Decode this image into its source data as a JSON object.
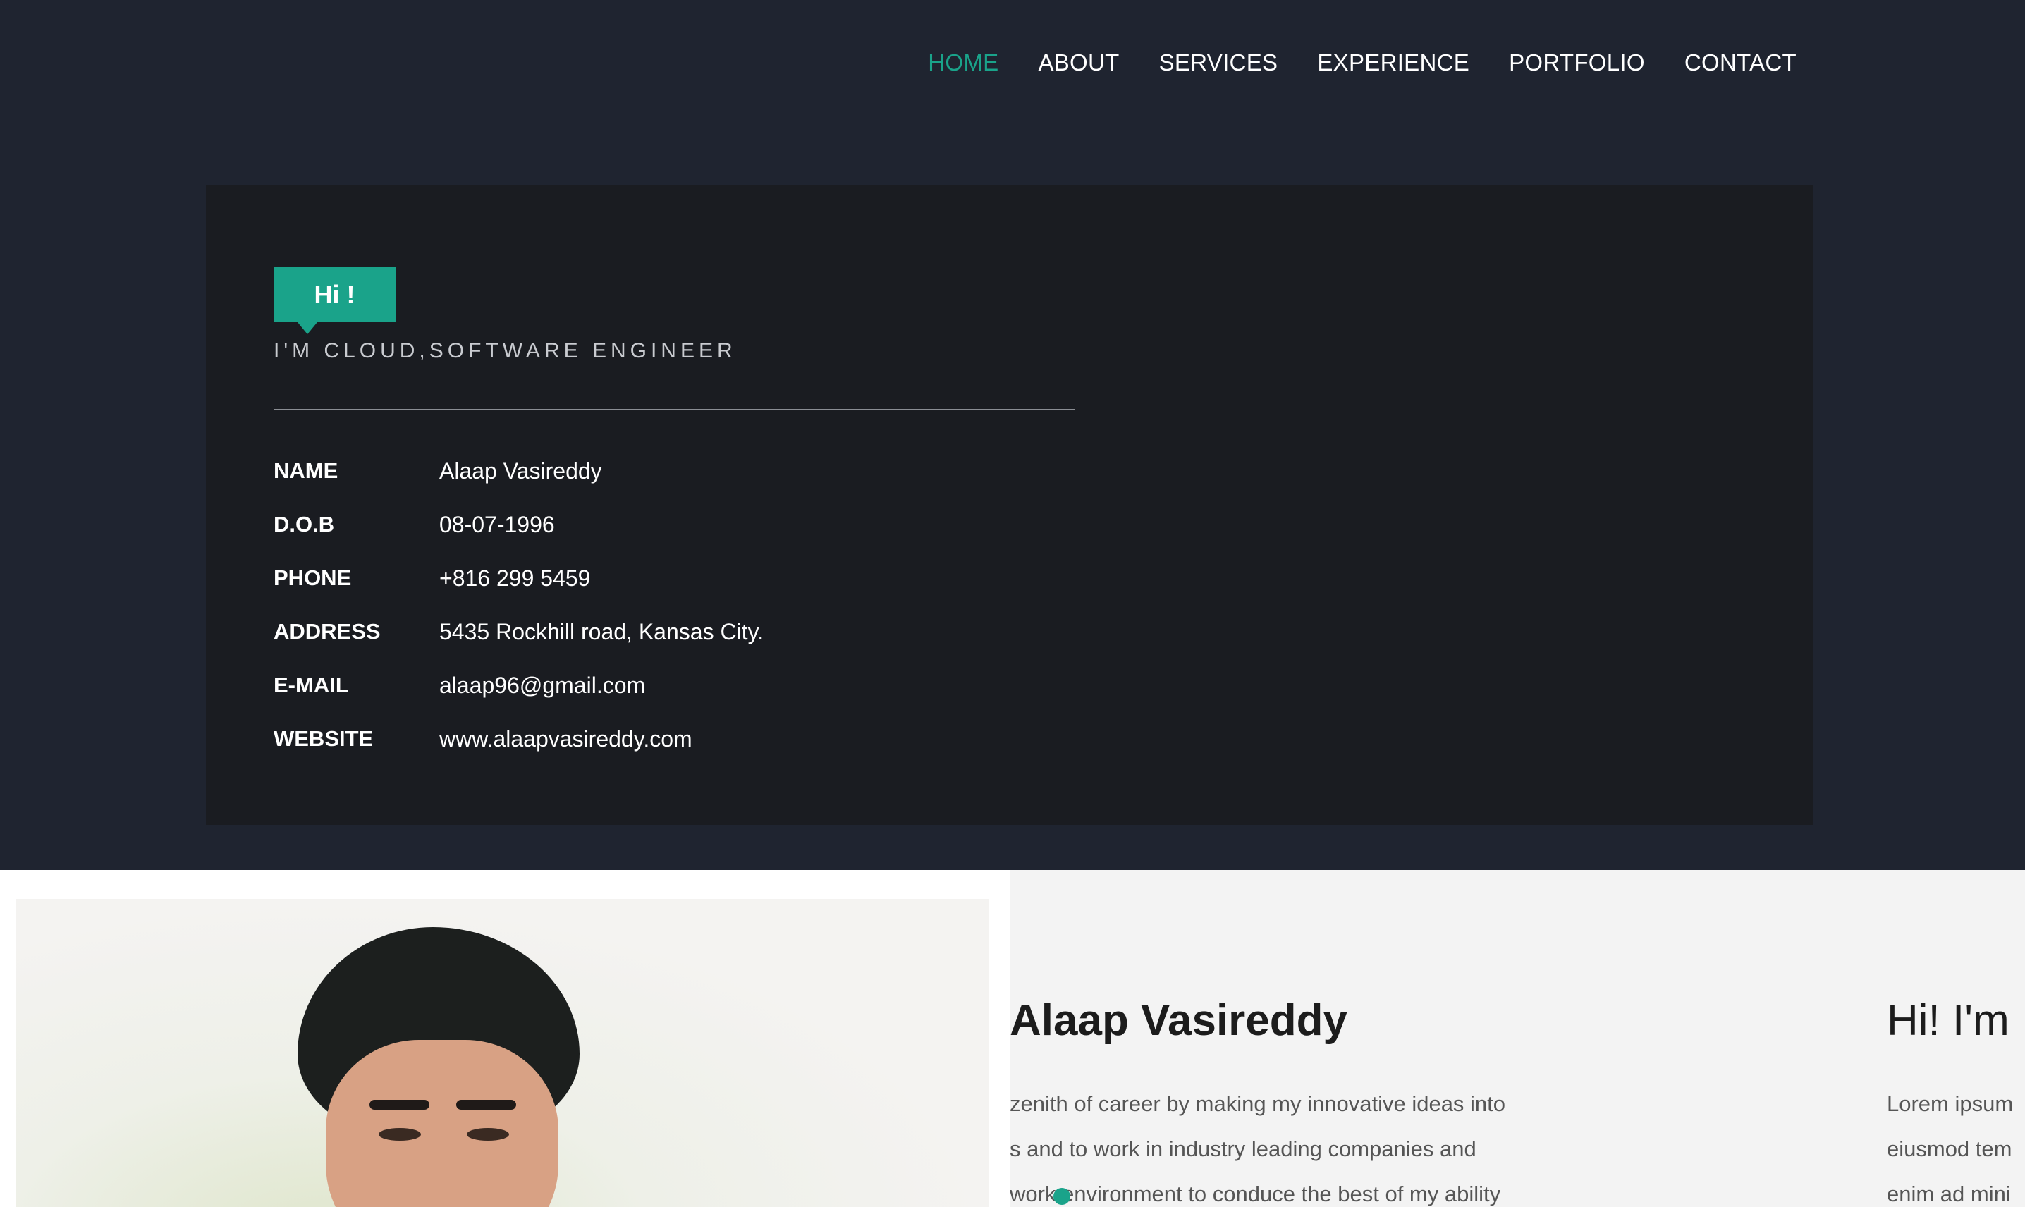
{
  "nav": {
    "items": [
      "HOME",
      "ABOUT",
      "SERVICES",
      "EXPERIENCE",
      "PORTFOLIO",
      "CONTACT"
    ],
    "active": "HOME"
  },
  "hero": {
    "badge": "Hi !",
    "role": "I'M CLOUD,SOFTWARE ENGINEER",
    "info": [
      {
        "key": "NAME",
        "value": "Alaap Vasireddy"
      },
      {
        "key": "D.O.B",
        "value": "08-07-1996"
      },
      {
        "key": "PHONE",
        "value": "+816 299 5459"
      },
      {
        "key": "ADDRESS",
        "value": "5435 Rockhill road, Kansas City."
      },
      {
        "key": "E-MAIL",
        "value": "alaap96@gmail.com"
      },
      {
        "key": "WEBSITE",
        "value": "www.alaapvasireddy.com"
      }
    ]
  },
  "about": {
    "slide1": {
      "name": "Alaap Vasireddy",
      "lines": [
        "zenith of career by making my innovative ideas into",
        "s and to work in industry leading companies and",
        "work environment to conduce the best of my ability"
      ]
    },
    "slide2": {
      "title": "Hi! I'm",
      "lines": [
        "Lorem ipsum",
        "eiusmod tem",
        "enim ad mini"
      ]
    }
  },
  "colors": {
    "accent": "#1aa38a",
    "page_bg": "#1f2430",
    "card_bg": "#1a1c21"
  }
}
